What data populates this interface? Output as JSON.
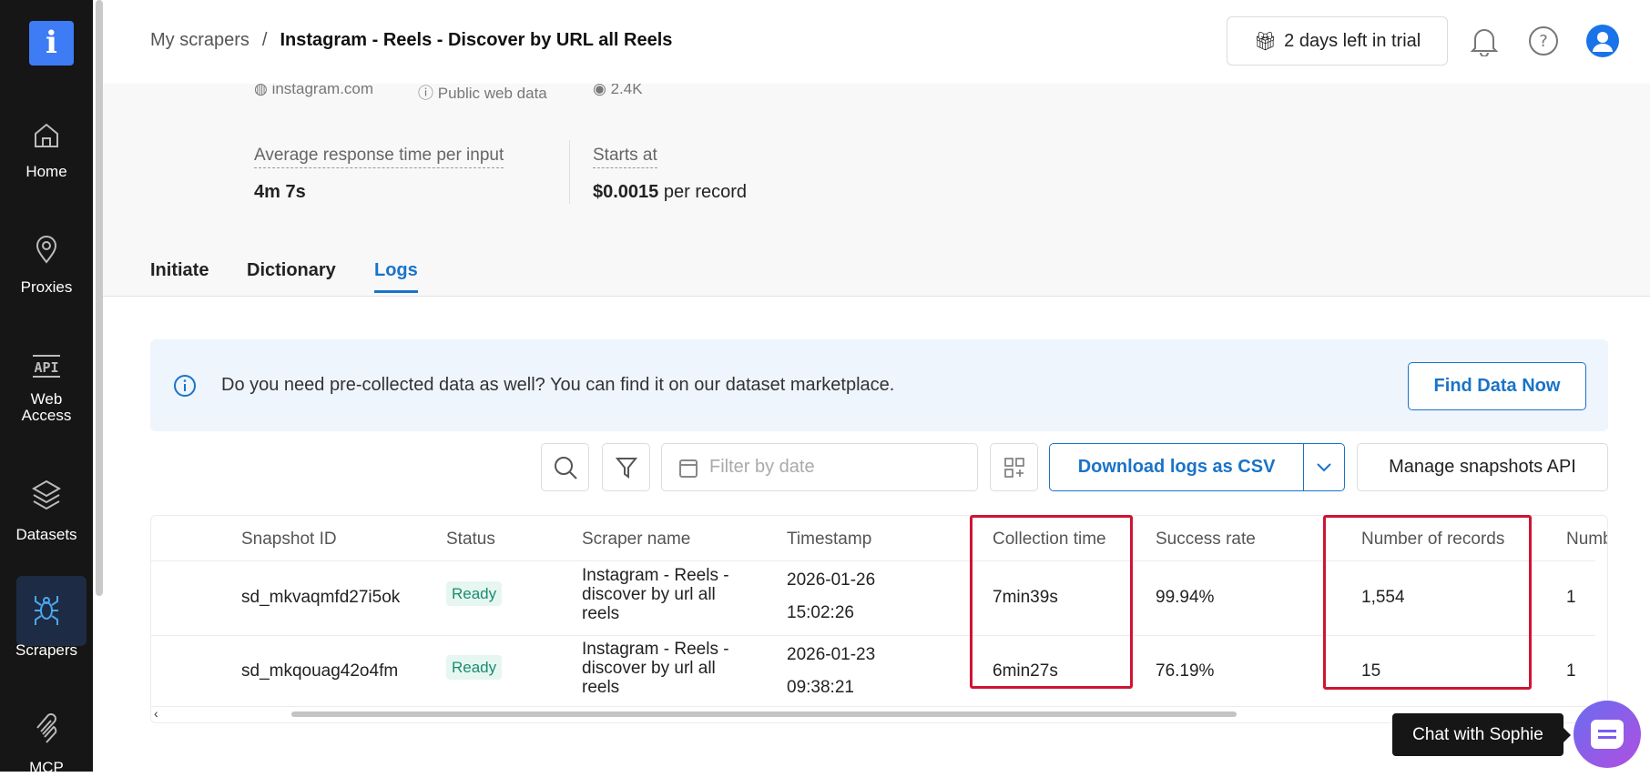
{
  "sidebar": {
    "logo": "i",
    "items": [
      {
        "label": "Home"
      },
      {
        "label": "Proxies"
      },
      {
        "label": "Web Access"
      },
      {
        "label": "Datasets"
      },
      {
        "label": "Scrapers"
      },
      {
        "label": "MCP"
      }
    ]
  },
  "header": {
    "breadcrumb_parent": "My scrapers",
    "breadcrumb_sep": "/",
    "breadcrumb_current": "Instagram - Reels - Discover by URL all Reels",
    "trial": "2 days left in trial"
  },
  "meta": {
    "domain": "instagram.com",
    "type": "Public web data",
    "users": "2.4K"
  },
  "stats": {
    "avg_label": "Average response time per input",
    "avg_value": "4m 7s",
    "starts_label": "Starts at",
    "starts_value": "$0.0015",
    "starts_unit": "per record"
  },
  "tabs": [
    "Initiate",
    "Dictionary",
    "Logs"
  ],
  "banner": {
    "text": "Do you need pre-collected data as well? You can find it on our dataset marketplace.",
    "button": "Find Data Now"
  },
  "toolbar": {
    "date_placeholder": "Filter by date",
    "download": "Download logs as CSV",
    "manage": "Manage snapshots API"
  },
  "table": {
    "columns": [
      "Snapshot ID",
      "Status",
      "Scraper name",
      "Timestamp",
      "Collection time",
      "Success rate",
      "Number of records",
      "Numb"
    ],
    "rows": [
      {
        "id": "sd_mkvaqmfd27i5ok",
        "status": "Ready",
        "scraper": "Instagram - Reels - discover by url all reels",
        "date": "2026-01-26",
        "time": "15:02:26",
        "collection": "7min39s",
        "success": "99.94%",
        "records": "1,554",
        "num": "1"
      },
      {
        "id": "sd_mkqouag42o4fm",
        "status": "Ready",
        "scraper": "Instagram - Reels - discover by url all reels",
        "date": "2026-01-23",
        "time": "09:38:21",
        "collection": "6min27s",
        "success": "76.19%",
        "records": "15",
        "num": "1"
      }
    ]
  },
  "chat": {
    "label": "Chat with Sophie"
  }
}
